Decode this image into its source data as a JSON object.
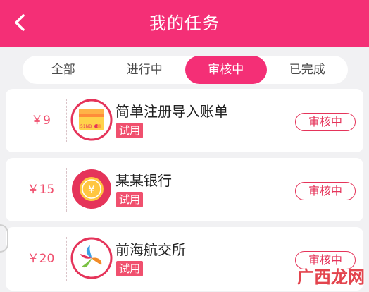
{
  "header": {
    "title": "我的任务",
    "back_icon": "chevron-left-icon",
    "bg_color": "#f42f76"
  },
  "tabs": [
    {
      "label": "全部",
      "active": false
    },
    {
      "label": "进行中",
      "active": false
    },
    {
      "label": "审核中",
      "active": true
    },
    {
      "label": "已完成",
      "active": false
    }
  ],
  "tasks": [
    {
      "price": "￥9",
      "name": "简单注册导入账单",
      "tag": "试用",
      "status": "审核中",
      "icon": "card-app-icon",
      "logo_text": "51NB"
    },
    {
      "price": "￥15",
      "name": "某某银行",
      "tag": "试用",
      "status": "审核中",
      "icon": "yen-coin-icon"
    },
    {
      "price": "￥20",
      "name": "前海航交所",
      "tag": "试用",
      "status": "审核中",
      "icon": "pinwheel-logo-icon"
    }
  ],
  "watermark": "广西龙网",
  "colors": {
    "accent": "#f42f76",
    "price": "#f0506e",
    "status_border": "#e5345a"
  }
}
